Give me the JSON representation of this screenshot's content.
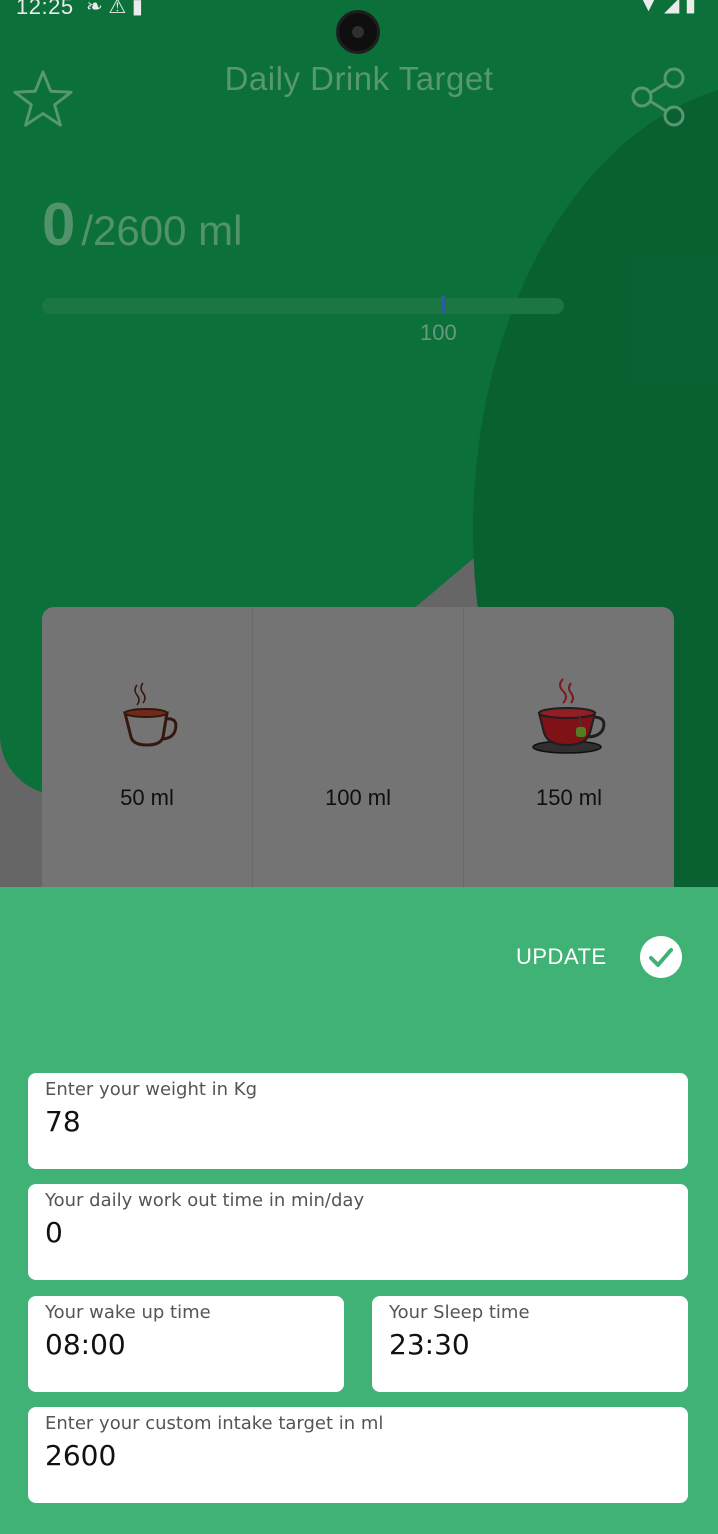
{
  "status_bar": {
    "time": "12:25",
    "left_icons": [
      "leaf-icon",
      "warning-icon",
      "sim-icon"
    ],
    "right_icons": [
      "wifi-icon",
      "signal-icon",
      "battery-icon"
    ]
  },
  "header": {
    "title": "Daily Drink Target"
  },
  "progress": {
    "current": "0",
    "target": "/2600 ml",
    "marker_label": "100"
  },
  "cups": [
    {
      "label": "50 ml",
      "icon": "coffee-cup-icon"
    },
    {
      "label": "100 ml",
      "icon": ""
    },
    {
      "label": "150 ml",
      "icon": "tea-cup-icon"
    }
  ],
  "sheet": {
    "update_label": "UPDATE",
    "fields": {
      "weight": {
        "label": "Enter your weight in Kg",
        "value": "78"
      },
      "workout": {
        "label": "Your daily work out time in min/day",
        "value": "0"
      },
      "wake": {
        "label": "Your wake up time",
        "value": "08:00"
      },
      "sleep": {
        "label": "Your Sleep time",
        "value": "23:30"
      },
      "custom": {
        "label": "Enter your custom intake target in ml",
        "value": "2600"
      }
    }
  },
  "colors": {
    "header_green": "#0c7a3f",
    "sheet_green": "#41b275",
    "white": "#ffffff"
  }
}
